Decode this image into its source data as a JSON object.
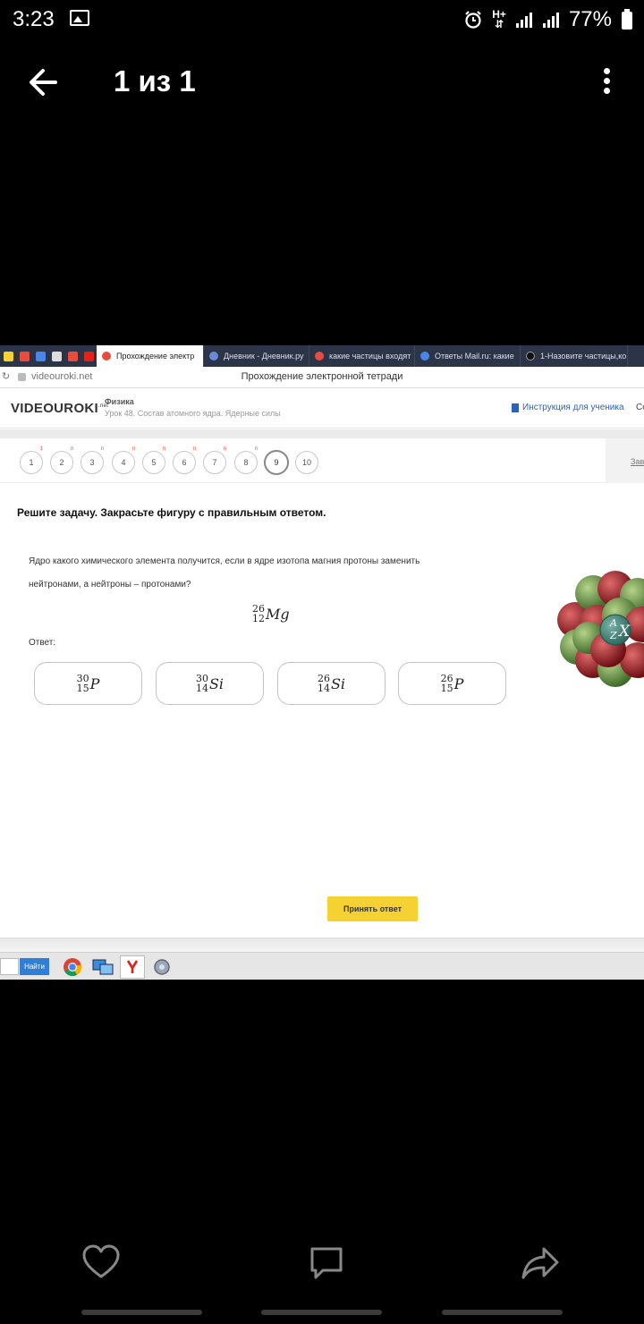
{
  "status_bar": {
    "time": "3:23",
    "network": "H+",
    "battery": "77%"
  },
  "viewer": {
    "title": "1 из 1"
  },
  "browser": {
    "tabs": [
      {
        "label": "Прохождение электр",
        "active": true,
        "color": "#e84c3d"
      },
      {
        "label": "Дневник - Дневник.ру",
        "active": false,
        "color": "#6b8ad6"
      },
      {
        "label": "какие частицы входят",
        "active": false,
        "color": "#e84c3d"
      },
      {
        "label": "Ответы Mail.ru: какие",
        "active": false,
        "color": "#2a64b8"
      },
      {
        "label": "1-Назовите частицы,ко",
        "active": false,
        "color": "#111111"
      }
    ],
    "tab_close": "×",
    "url": "videouroki.net",
    "page_title": "Прохождение электронной тетради"
  },
  "site": {
    "logo_main": "VIDEOUROKI",
    "logo_suffix": ".net",
    "subject": "Физика",
    "lesson": "Урок 48. Состав атомного ядра. Ядерные силы",
    "instruction_link": "Инструкция для ученика",
    "header_cut": "Со",
    "side_link": "Зав"
  },
  "question_nav": {
    "numbers": [
      "1",
      "2",
      "3",
      "4",
      "5",
      "6",
      "7",
      "8",
      "9",
      "10"
    ],
    "current": "9"
  },
  "task": {
    "title": "Решите задачу. Закрасьте фигуру с правильным ответом.",
    "question_line1": "Ядро какого химического элемента получится, если в ядре изотопа магния протоны заменить",
    "question_line2": "нейтронами, а нейтроны – протонами?",
    "isotope": {
      "mass": "26",
      "charge": "12",
      "symbol": "Mg"
    },
    "answer_label": "Ответ:",
    "options": [
      {
        "mass": "30",
        "charge": "15",
        "symbol": "P"
      },
      {
        "mass": "30",
        "charge": "14",
        "symbol": "Si"
      },
      {
        "mass": "26",
        "charge": "14",
        "symbol": "Si"
      },
      {
        "mass": "26",
        "charge": "15",
        "symbol": "P"
      }
    ],
    "atom_label": {
      "mass": "A",
      "charge": "Z",
      "symbol": "X"
    },
    "submit": "Принять ответ"
  },
  "taskbar": {
    "find_button": "Найти"
  },
  "colors": {
    "accent_yellow": "#f5d132",
    "brand_red": "#e84c3d",
    "link_blue": "#2a64b8"
  }
}
